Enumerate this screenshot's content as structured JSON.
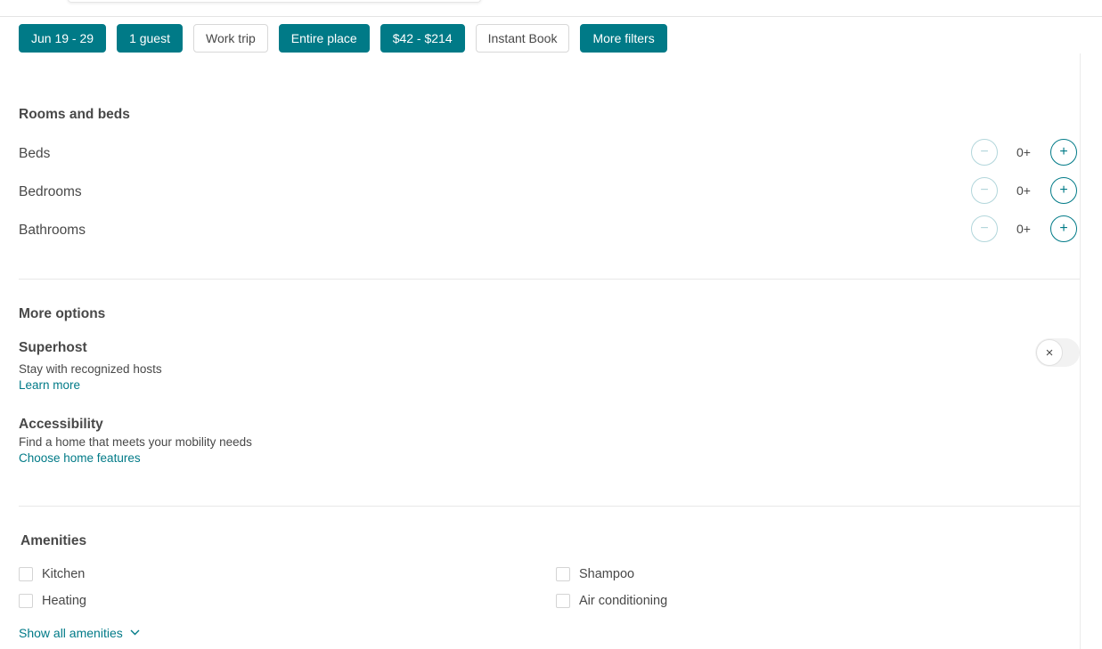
{
  "filters": [
    {
      "label": "Jun 19 - 29",
      "active": true
    },
    {
      "label": "1 guest",
      "active": true
    },
    {
      "label": "Work trip",
      "active": false
    },
    {
      "label": "Entire place",
      "active": true
    },
    {
      "label": "$42 - $214",
      "active": true
    },
    {
      "label": "Instant Book",
      "active": false
    },
    {
      "label": "More filters",
      "active": true
    }
  ],
  "rooms": {
    "title": "Rooms and beds",
    "rows": [
      {
        "label": "Beds",
        "value": "0+"
      },
      {
        "label": "Bedrooms",
        "value": "0+"
      },
      {
        "label": "Bathrooms",
        "value": "0+"
      }
    ],
    "minus_symbol": "−",
    "plus_symbol": "+"
  },
  "more_options": {
    "title": "More options",
    "superhost": {
      "title": "Superhost",
      "description": "Stay with recognized hosts",
      "link": "Learn more",
      "toggle_icon": "×",
      "enabled": false
    },
    "accessibility": {
      "title": "Accessibility",
      "description": "Find a home that meets your mobility needs",
      "link": "Choose home features"
    }
  },
  "amenities": {
    "title": "Amenities",
    "items": [
      {
        "label": "Kitchen",
        "checked": false
      },
      {
        "label": "Shampoo",
        "checked": false
      },
      {
        "label": "Heating",
        "checked": false
      },
      {
        "label": "Air conditioning",
        "checked": false
      }
    ],
    "show_all": "Show all amenities",
    "show_all_icon": "chevron-down-icon"
  },
  "colors": {
    "accent": "#007a87",
    "text": "#484848",
    "border": "#d8d8d8"
  }
}
